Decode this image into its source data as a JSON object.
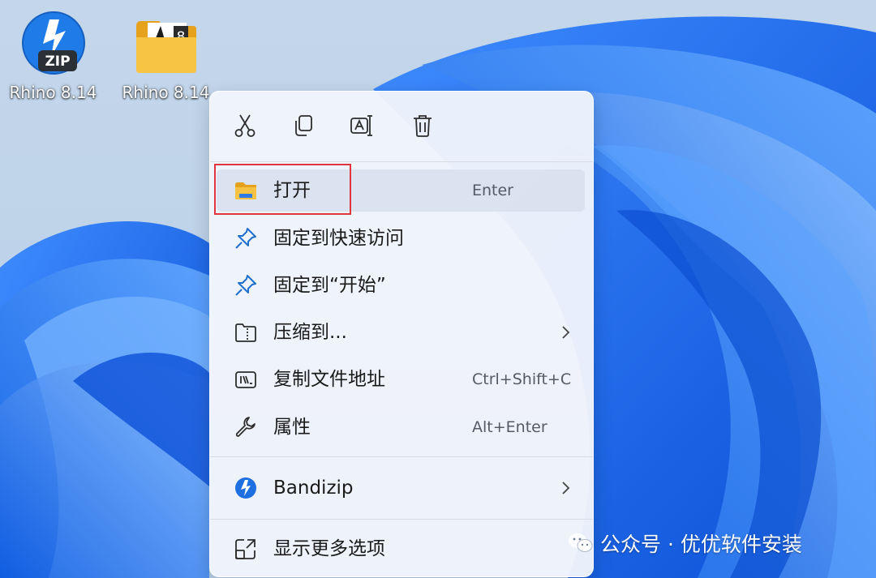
{
  "desktop": {
    "icons": [
      {
        "label": "Rhino 8.14",
        "kind": "zip-archive-icon",
        "badge": "ZIP"
      },
      {
        "label": "Rhino 8.14",
        "kind": "folder-icon",
        "badge": "8"
      }
    ]
  },
  "context_menu": {
    "toolbar": [
      "cut-icon",
      "copy-icon",
      "rename-icon",
      "delete-icon"
    ],
    "items": [
      {
        "label": "打开",
        "shortcut": "Enter",
        "icon": "folder-icon",
        "highlighted": true
      },
      {
        "label": "固定到快速访问",
        "shortcut": "",
        "icon": "pin-icon"
      },
      {
        "label": "固定到“开始”",
        "shortcut": "",
        "icon": "pin-icon"
      },
      {
        "label": "压缩到...",
        "shortcut": "",
        "icon": "compress-folder-icon",
        "submenu": true
      },
      {
        "label": "复制文件地址",
        "shortcut": "Ctrl+Shift+C",
        "icon": "copy-path-icon"
      },
      {
        "label": "属性",
        "shortcut": "Alt+Enter",
        "icon": "wrench-icon"
      },
      {
        "label": "Bandizip",
        "shortcut": "",
        "icon": "bandizip-icon",
        "submenu": true
      },
      {
        "label": "显示更多选项",
        "shortcut": "",
        "icon": "show-more-icon"
      }
    ]
  },
  "watermark": {
    "text": "公众号 · 优优软件安装"
  },
  "colors": {
    "highlight_box": "#e0353f",
    "menu_background": "#f0f4fb",
    "wallpaper_blue": "#1a73e8"
  }
}
